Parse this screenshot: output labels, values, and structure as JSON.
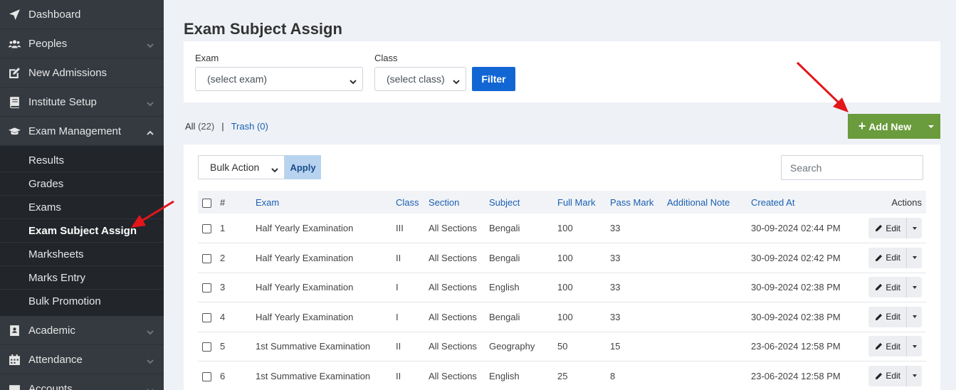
{
  "sidebar": {
    "items": [
      {
        "label": "Dashboard",
        "icon": "rocket-icon",
        "has_chevron": false
      },
      {
        "label": "Peoples",
        "icon": "users-icon",
        "has_chevron": true
      },
      {
        "label": "New Admissions",
        "icon": "edit-icon",
        "has_chevron": false
      },
      {
        "label": "Institute Setup",
        "icon": "book-icon",
        "has_chevron": true
      },
      {
        "label": "Exam Management",
        "icon": "graduation-cap-icon",
        "has_chevron": true,
        "open": true
      }
    ],
    "submenu": [
      "Results",
      "Grades",
      "Exams",
      "Exam Subject Assign",
      "Marksheets",
      "Marks Entry",
      "Bulk Promotion"
    ],
    "active_sub": "Exam Subject Assign",
    "items_after": [
      {
        "label": "Academic",
        "icon": "id-card-icon",
        "has_chevron": true
      },
      {
        "label": "Attendance",
        "icon": "calendar-icon",
        "has_chevron": true
      },
      {
        "label": "Accounts",
        "icon": "wallet-icon",
        "has_chevron": true
      }
    ]
  },
  "page": {
    "title": "Exam Subject Assign"
  },
  "filter": {
    "exam_label": "Exam",
    "exam_value": "(select exam)",
    "class_label": "Class",
    "class_value": "(select class)",
    "button": "Filter"
  },
  "tabs": {
    "all_label": "All",
    "all_count": "(22)",
    "separator": "|",
    "trash_label": "Trash",
    "trash_count": "(0)"
  },
  "add_new": {
    "label": "Add New"
  },
  "bulk": {
    "value": "Bulk Action",
    "apply": "Apply"
  },
  "search": {
    "placeholder": "Search"
  },
  "table": {
    "headers": {
      "num": "#",
      "exam": "Exam",
      "class": "Class",
      "section": "Section",
      "subject": "Subject",
      "full_mark": "Full Mark",
      "pass_mark": "Pass Mark",
      "note": "Additional Note",
      "created": "Created At",
      "actions": "Actions"
    },
    "edit_label": "Edit",
    "rows": [
      {
        "num": "1",
        "exam": "Half Yearly Examination",
        "class": "III",
        "section": "All Sections",
        "subject": "Bengali",
        "full_mark": "100",
        "pass_mark": "33",
        "note": "",
        "created": "30-09-2024 02:44 PM"
      },
      {
        "num": "2",
        "exam": "Half Yearly Examination",
        "class": "II",
        "section": "All Sections",
        "subject": "Bengali",
        "full_mark": "100",
        "pass_mark": "33",
        "note": "",
        "created": "30-09-2024 02:42 PM"
      },
      {
        "num": "3",
        "exam": "Half Yearly Examination",
        "class": "I",
        "section": "All Sections",
        "subject": "English",
        "full_mark": "100",
        "pass_mark": "33",
        "note": "",
        "created": "30-09-2024 02:38 PM"
      },
      {
        "num": "4",
        "exam": "Half Yearly Examination",
        "class": "I",
        "section": "All Sections",
        "subject": "Bengali",
        "full_mark": "100",
        "pass_mark": "33",
        "note": "",
        "created": "30-09-2024 02:38 PM"
      },
      {
        "num": "5",
        "exam": "1st Summative Examination",
        "class": "II",
        "section": "All Sections",
        "subject": "Geography",
        "full_mark": "50",
        "pass_mark": "15",
        "note": "",
        "created": "23-06-2024 12:58 PM"
      },
      {
        "num": "6",
        "exam": "1st Summative Examination",
        "class": "II",
        "section": "All Sections",
        "subject": "English",
        "full_mark": "25",
        "pass_mark": "8",
        "note": "",
        "created": "23-06-2024 12:58 PM"
      }
    ]
  },
  "colors": {
    "add_new": "#6a9b3c",
    "filter": "#1266d4",
    "sidebar": "#343a40",
    "link": "#1a5fb4",
    "annotation_arrow": "#e3161b"
  }
}
